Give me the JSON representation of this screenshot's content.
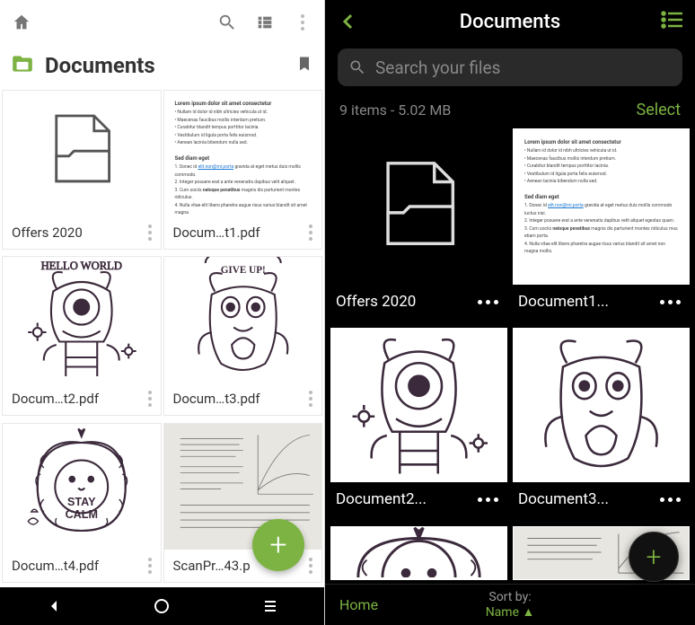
{
  "left": {
    "title": "Documents",
    "fab": "+",
    "files": [
      {
        "name": "Offers 2020",
        "thumb": "folder"
      },
      {
        "name": "Docum…t1.pdf",
        "thumb": "doclines"
      },
      {
        "name": "Docum…t2.pdf",
        "thumb": "monster1"
      },
      {
        "name": "Docum…t3.pdf",
        "thumb": "monster2"
      },
      {
        "name": "Docum…t4.pdf",
        "thumb": "lion"
      },
      {
        "name": "ScanPr…43.p",
        "thumb": "scan"
      }
    ]
  },
  "right": {
    "title": "Documents",
    "search_placeholder": "Search your files",
    "status": "9 items - 5.02 MB",
    "select_label": "Select",
    "fab": "+",
    "files": [
      {
        "name": "Offers 2020",
        "thumb": "folder_dark"
      },
      {
        "name": "Document1...",
        "thumb": "doclines"
      },
      {
        "name": "Document2...",
        "thumb": "monster1"
      },
      {
        "name": "Document3...",
        "thumb": "monster2"
      },
      {
        "name": "",
        "thumb": "lion_cut"
      },
      {
        "name": "",
        "thumb": "scan_cut"
      }
    ],
    "bottom": {
      "home": "Home",
      "sort_label": "Sort by:",
      "sort_value": "Name ▲"
    }
  },
  "icons": {
    "accent": "#7cb342"
  }
}
